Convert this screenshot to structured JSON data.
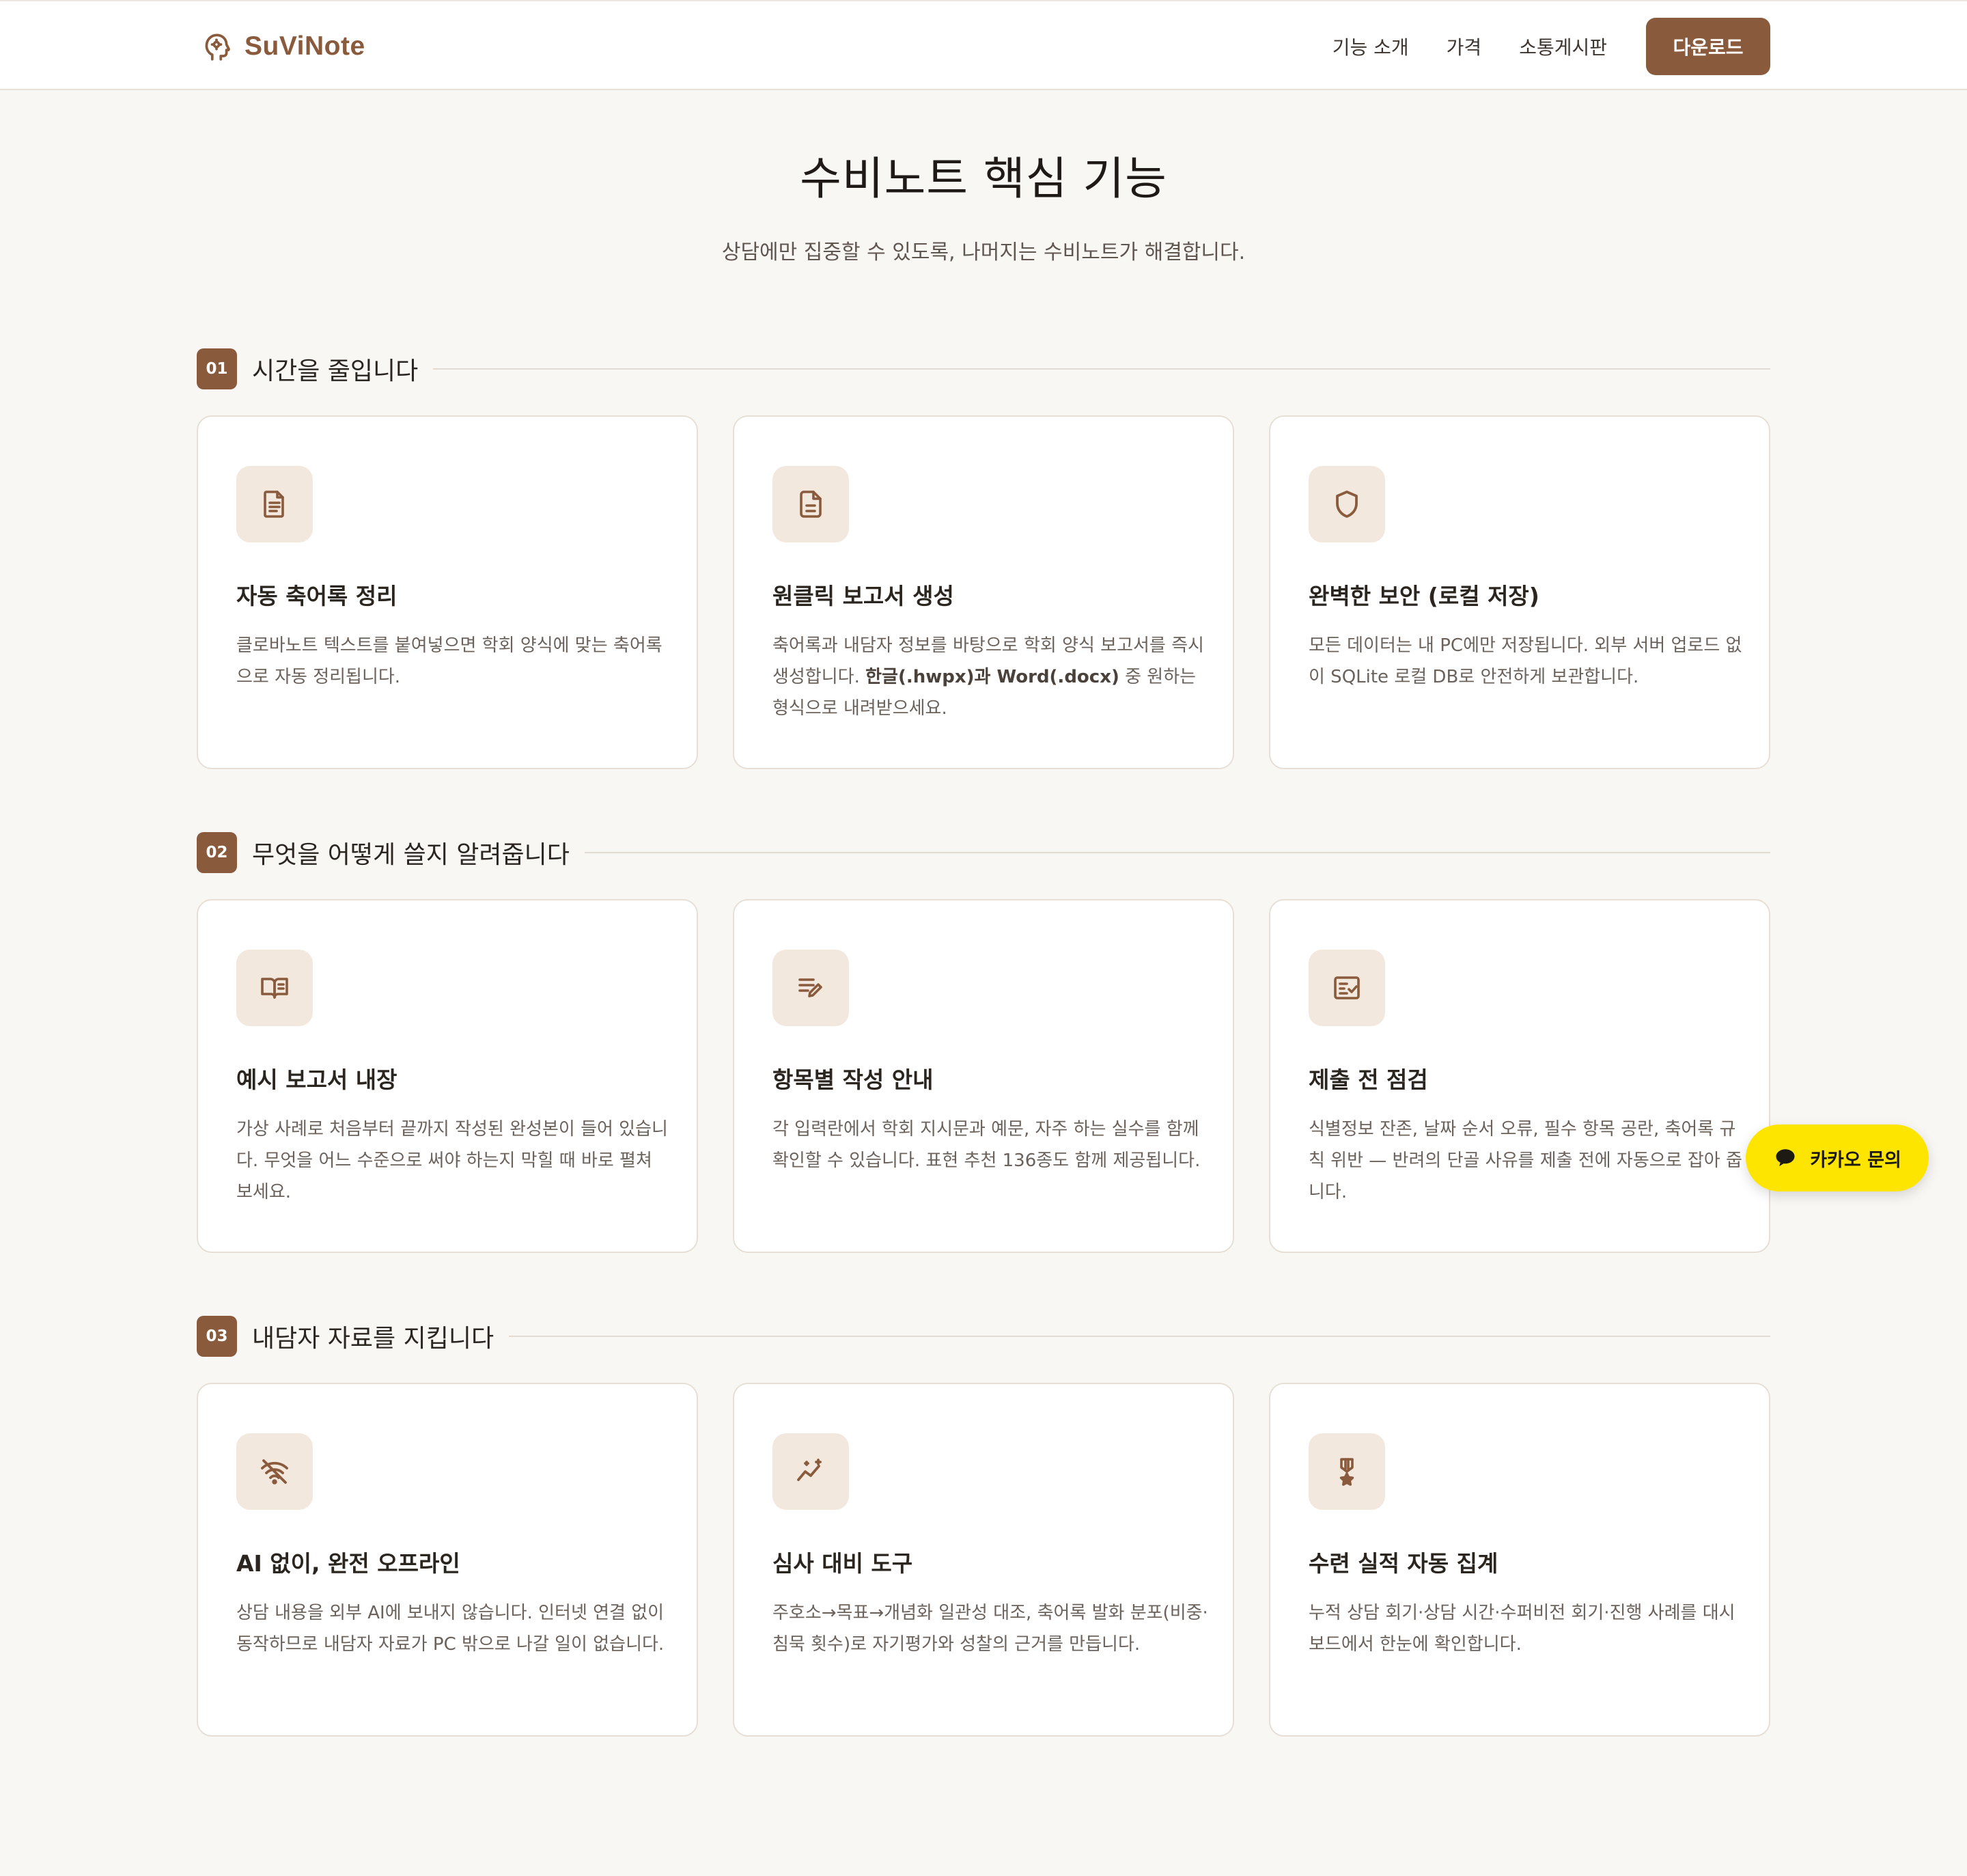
{
  "header": {
    "brand": "SuViNote",
    "nav": [
      "기능 소개",
      "가격",
      "소통게시판"
    ],
    "download_label": "다운로드"
  },
  "hero": {
    "title": "수비노트 핵심 기능",
    "subtitle": "상담에만 집중할 수 있도록, 나머지는 수비노트가 해결합니다."
  },
  "sections": [
    {
      "number": "01",
      "title": "시간을 줄입니다",
      "cards": [
        {
          "icon": "document-icon",
          "title": "자동 축어록 정리",
          "desc": "클로바노트 텍스트를 붙여넣으면 학회 양식에 맞는 축어록으로 자동 정리됩니다."
        },
        {
          "icon": "file-icon",
          "title": "원클릭 보고서 생성",
          "desc_before": "축어록과 내담자 정보를 바탕으로 학회 양식 보고서를 즉시 생성합니다. ",
          "desc_bold": "한글(.hwpx)과 Word(.docx)",
          "desc_after": " 중 원하는 형식으로 내려받으세요."
        },
        {
          "icon": "shield-icon",
          "title": "완벽한 보안 (로컬 저장)",
          "desc": "모든 데이터는 내 PC에만 저장됩니다. 외부 서버 업로드 없이 SQLite 로컬 DB로 안전하게 보관합니다."
        }
      ]
    },
    {
      "number": "02",
      "title": "무엇을 어떻게 쓸지 알려줍니다",
      "cards": [
        {
          "icon": "book-open-icon",
          "title": "예시 보고서 내장",
          "desc": "가상 사례로 처음부터 끝까지 작성된 완성본이 들어 있습니다. 무엇을 어느 수준으로 써야 하는지 막힐 때 바로 펼쳐 보세요."
        },
        {
          "icon": "list-pencil-icon",
          "title": "항목별 작성 안내",
          "desc": "각 입력란에서 학회 지시문과 예문, 자주 하는 실수를 함께 확인할 수 있습니다. 표현 추천 136종도 함께 제공됩니다."
        },
        {
          "icon": "checklist-icon",
          "title": "제출 전 점검",
          "desc": "식별정보 잔존, 날짜 순서 오류, 필수 항목 공란, 축어록 규칙 위반 — 반려의 단골 사유를 제출 전에 자동으로 잡아 줍니다."
        }
      ]
    },
    {
      "number": "03",
      "title": "내담자 자료를 지킵니다",
      "cards": [
        {
          "icon": "wifi-off-icon",
          "title": "AI 없이, 완전 오프라인",
          "desc": "상담 내용을 외부 AI에 보내지 않습니다. 인터넷 연결 없이 동작하므로 내담자 자료가 PC 밖으로 나갈 일이 없습니다."
        },
        {
          "icon": "trend-sparkle-icon",
          "title": "심사 대비 도구",
          "desc": "주호소→목표→개념화 일관성 대조, 축어록 발화 분포(비중·침묵 횟수)로 자기평가와 성찰의 근거를 만듭니다."
        },
        {
          "icon": "medal-icon",
          "title": "수련 실적 자동 집계",
          "desc": "누적 상담 회기·상담 시간·수퍼비전 회기·진행 사례를 대시보드에서 한눈에 확인합니다."
        }
      ]
    }
  ],
  "floating": {
    "kakao_label": "카카오 문의"
  },
  "colors": {
    "accent": "#8a5a3c",
    "background": "#f9f7f4",
    "icon_tile": "#f2e8de",
    "kakao": "#fee500"
  }
}
